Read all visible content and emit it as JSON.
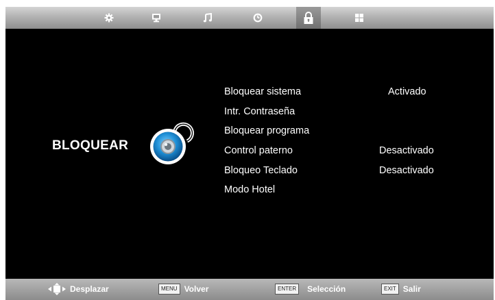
{
  "tabs": [
    {
      "icon": "settings-gear-icon"
    },
    {
      "icon": "picture-monitor-icon"
    },
    {
      "icon": "sound-music-note-icon"
    },
    {
      "icon": "time-clock-icon"
    },
    {
      "icon": "lock-padlock-icon",
      "active": true
    },
    {
      "icon": "channel-grid-icon"
    }
  ],
  "section": {
    "title": "BLOQUEAR",
    "icon": "lock-icon"
  },
  "menu": {
    "items": [
      {
        "label": "Bloquear sistema",
        "value": "Activado"
      },
      {
        "label": "Intr. Contraseña",
        "value": ""
      },
      {
        "label": "Bloquear programa",
        "value": ""
      },
      {
        "label": "Control paterno",
        "value": "Desactivado"
      },
      {
        "label": "Bloqueo Teclado",
        "value": "Desactivado"
      },
      {
        "label": "Modo Hotel",
        "value": ""
      }
    ]
  },
  "footer": {
    "move_label": "Desplazar",
    "menu_key": "MENU",
    "menu_label": "Volver",
    "enter_key": "ENTER",
    "enter_label": "Selección",
    "exit_key": "EXIT",
    "exit_label": "Salir"
  },
  "colors": {
    "background": "#000000",
    "bar_gray": "#a8a8a8",
    "lock_blue": "#1e8fd6",
    "text": "#ffffff"
  }
}
